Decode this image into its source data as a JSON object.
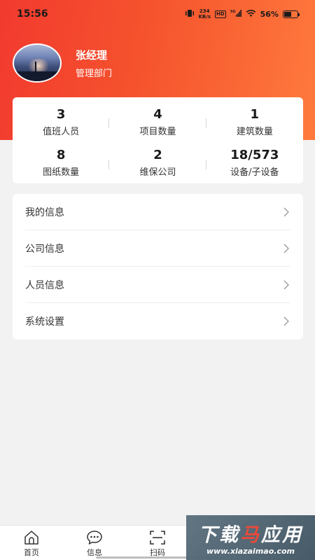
{
  "status_bar": {
    "time": "15:56",
    "net_speed": "234",
    "net_unit": "KB/s",
    "hd": "HD",
    "signal_type": "5G",
    "battery_percent": "56%",
    "battery_level": 0.56
  },
  "profile": {
    "name": "张经理",
    "department": "管理部门"
  },
  "stats": [
    {
      "value": "3",
      "label": "值班人员"
    },
    {
      "value": "4",
      "label": "项目数量"
    },
    {
      "value": "1",
      "label": "建筑数量"
    },
    {
      "value": "8",
      "label": "图纸数量"
    },
    {
      "value": "2",
      "label": "维保公司"
    },
    {
      "value": "18/573",
      "label": "设备/子设备"
    }
  ],
  "menu": [
    {
      "label": "我的信息"
    },
    {
      "label": "公司信息"
    },
    {
      "label": "人员信息"
    },
    {
      "label": "系统设置"
    }
  ],
  "bottom_nav": [
    {
      "label": "首页",
      "icon": "home-icon"
    },
    {
      "label": "信息",
      "icon": "message-icon"
    },
    {
      "label": "扫码",
      "icon": "scan-icon"
    }
  ],
  "watermark": {
    "main_a": "下载",
    "main_b": "马",
    "main_c": "应用",
    "sub": "www.xiazaimao.com"
  },
  "colors": {
    "header_start": "#f23a2f",
    "header_end": "#ff7a3d",
    "background": "#f2f2f2"
  }
}
